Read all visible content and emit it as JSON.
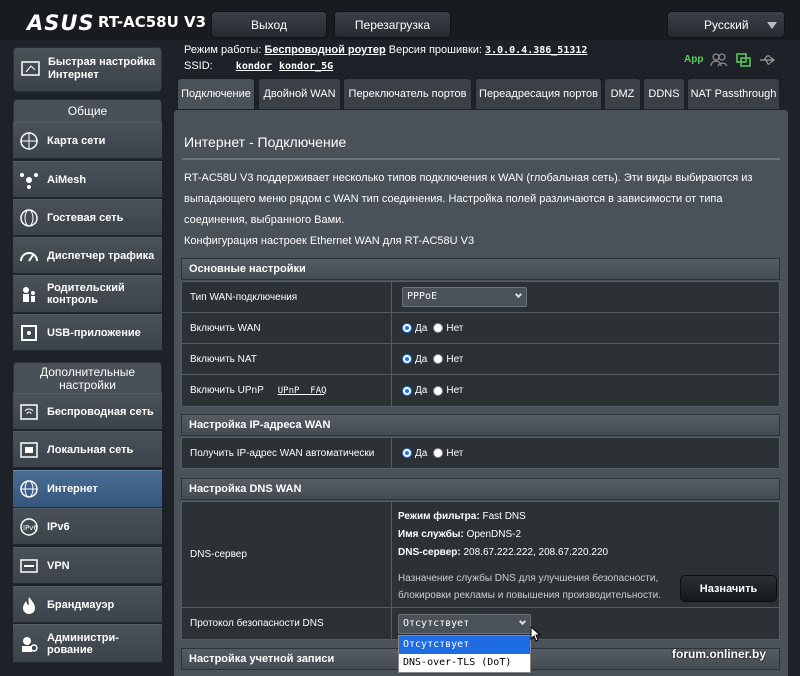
{
  "header": {
    "logo": "ASUS",
    "model": "RT-AC58U V3",
    "logout_label": "Выход",
    "reboot_label": "Перезагрузка",
    "language": "Русский"
  },
  "info": {
    "mode_label": "Режим работы:",
    "mode_value": "Беспроводной роутер",
    "fw_label": "Версия прошивки:",
    "fw_value": "3.0.0.4.386_51312",
    "ssid_label": "SSID:",
    "ssid1": "kondor",
    "ssid2": "kondor_5G",
    "app_label": "App"
  },
  "sidebar": {
    "quick_setup": "Быстрая настройка Интернет",
    "general_header": "Общие",
    "general_items": [
      "Карта сети",
      "AiMesh",
      "Гостевая сеть",
      "Диспетчер трафика",
      "Родительский контроль",
      "USB-приложение"
    ],
    "advanced_header": "Дополнительные настройки",
    "advanced_items": [
      "Беспроводная сеть",
      "Локальная сеть",
      "Интернет",
      "IPv6",
      "VPN",
      "Брандмауэр",
      "Администри-рование"
    ]
  },
  "tabs": [
    "Подключение",
    "Двойной WAN",
    "Переключатель портов",
    "Переадресация портов",
    "DMZ",
    "DDNS",
    "NAT Passthrough"
  ],
  "page": {
    "title": "Интернет - Подключение",
    "desc": "RT-AC58U V3 поддерживает несколько типов подключения к WAN (глобальная сеть). Эти виды выбираются из выпадающего меню рядом с WAN тип соединения. Настройка полей различаются в зависимости от типа соединения, выбранного Вами.",
    "config": "Конфигурация настроек Ethernet WAN для RT-AC58U V3"
  },
  "basic": {
    "header": "Основные настройки",
    "wan_type_label": "Тип WAN-подключения",
    "wan_type_value": "PPPoE",
    "enable_wan": "Включить WAN",
    "enable_nat": "Включить NAT",
    "enable_upnp": "Включить UPnP",
    "upnp_faq": "UPnP  FAQ",
    "yes": "Да",
    "no": "Нет"
  },
  "ip": {
    "header": "Настройка IP-адреса WAN",
    "auto_label": "Получить IP-адрес WAN автоматически"
  },
  "dns": {
    "header": "Настройка DNS WAN",
    "server_label": "DNS-сервер",
    "filter_label": "Режим фильтра:",
    "filter_value": "Fast DNS",
    "service_label": "Имя службы:",
    "service_value": "OpenDNS-2",
    "dns_label": "DNS-сервер:",
    "dns_value": "208.67.222.222, 208.67.220.220",
    "note": "Назначение службы DNS для улучшения безопасности, блокировки рекламы и повышения производительности.",
    "assign_label": "Назначить",
    "protocol_label": "Протокол безопасности DNS",
    "protocol_value": "Отсутствует",
    "options": [
      "Отсутствует",
      "DNS-over-TLS (DoT)"
    ]
  },
  "account": {
    "header": "Настройка учетной записи"
  },
  "watermark": "forum.onliner.by"
}
